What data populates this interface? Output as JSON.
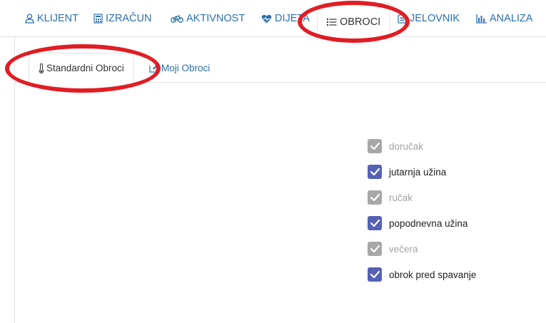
{
  "colors": {
    "link": "#2c6fad",
    "checkbox_enabled": "#5561b5",
    "checkbox_disabled": "#a7a7a7",
    "highlight": "#e11d24"
  },
  "top_nav": {
    "tabs": [
      {
        "label": "KLIJENT",
        "icon": "user-icon"
      },
      {
        "label": "IZRAČUN",
        "icon": "calculator-icon"
      },
      {
        "label": "AKTIVNOST",
        "icon": "bicycle-icon"
      },
      {
        "label": "DIJETA",
        "icon": "heartbeat-icon"
      },
      {
        "label": "OBROCI",
        "icon": "list-icon",
        "active": true
      },
      {
        "label": "JELOVNIK",
        "icon": "menu-icon"
      },
      {
        "label": "ANALIZA",
        "icon": "bar-chart-icon"
      }
    ]
  },
  "sub_nav": {
    "tabs": [
      {
        "label": "Standardni Obroci",
        "icon": "thermometer-icon",
        "active": true
      },
      {
        "label": "Moji Obroci",
        "icon": "edit-icon"
      }
    ]
  },
  "meals": [
    {
      "label": "doručak",
      "checked": true,
      "enabled": false
    },
    {
      "label": "jutarnja užina",
      "checked": true,
      "enabled": true
    },
    {
      "label": "ručak",
      "checked": true,
      "enabled": false
    },
    {
      "label": "popodnevna užina",
      "checked": true,
      "enabled": true
    },
    {
      "label": "večera",
      "checked": true,
      "enabled": false
    },
    {
      "label": "obrok pred spavanje",
      "checked": true,
      "enabled": true
    }
  ]
}
